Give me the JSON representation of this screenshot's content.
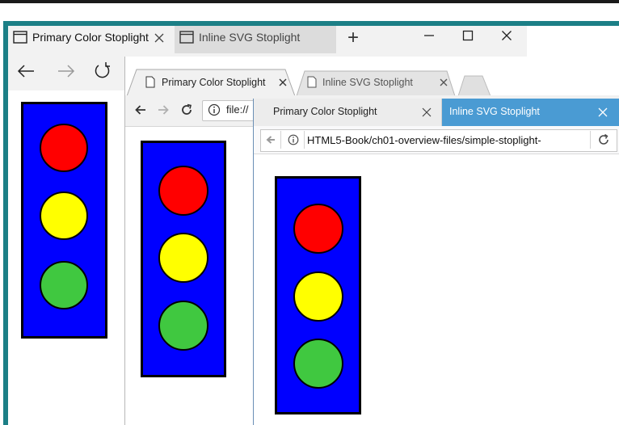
{
  "edge": {
    "tabs": [
      {
        "label": "Primary Color Stoplight",
        "active": true
      },
      {
        "label": "Inline SVG Stoplight",
        "active": false
      }
    ],
    "new_tab_symbol": "+",
    "icons": {
      "back": "arrow-left-icon",
      "forward": "arrow-right-icon",
      "refresh": "refresh-icon",
      "minimize": "minimize-icon",
      "maximize": "maximize-icon",
      "close": "close-icon",
      "tab_close": "close-icon",
      "tab_page": "page-icon"
    },
    "accent_color": "#1c7f86"
  },
  "chrome": {
    "tabs": [
      {
        "label": "Primary Color Stoplight",
        "active": true
      },
      {
        "label": "Inline SVG Stoplight",
        "active": false
      }
    ],
    "address_text": "file://",
    "icons": {
      "back": "arrow-left-icon",
      "forward": "arrow-right-icon",
      "reload": "reload-icon",
      "info": "info-icon",
      "tab_page": "page-icon",
      "tab_close": "close-icon"
    }
  },
  "firefox": {
    "tabs": [
      {
        "label": "Primary Color Stoplight",
        "active": false
      },
      {
        "label": "Inline SVG Stoplight",
        "active": true
      }
    ],
    "url_text": "HTML5-Book/ch01-overview-files/simple-stoplight-",
    "icons": {
      "back": "arrow-left-icon",
      "info": "info-icon",
      "reload": "reload-icon",
      "tab_close": "close-icon"
    },
    "accent_color": "#4a9bd3"
  },
  "stoplight": {
    "housing_color": "#0000ff",
    "lights": [
      {
        "name": "red",
        "color": "#ff0000"
      },
      {
        "name": "yellow",
        "color": "#ffff00"
      },
      {
        "name": "green",
        "color": "#40c840"
      }
    ]
  }
}
